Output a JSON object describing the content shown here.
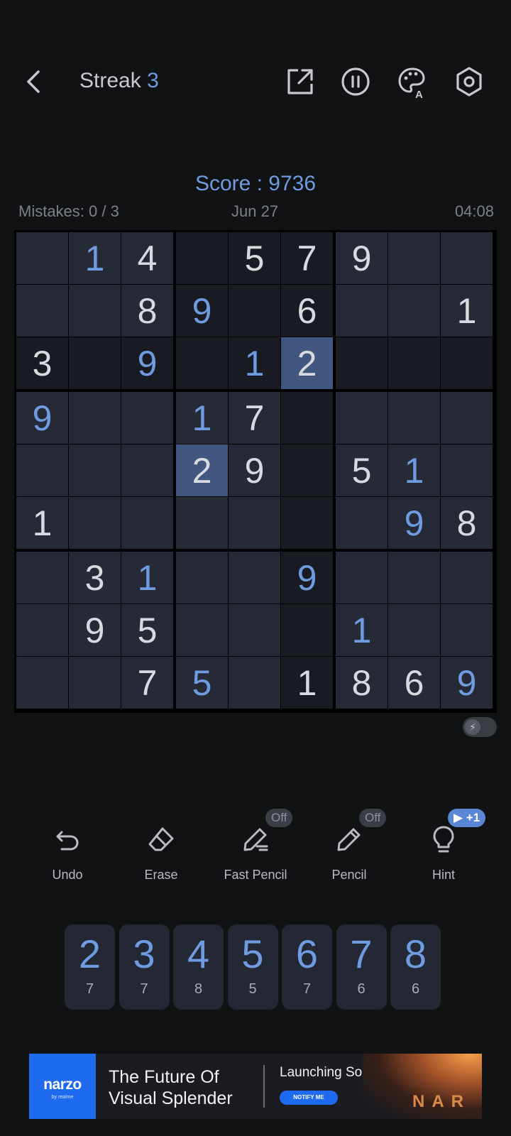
{
  "header": {
    "streak_label": "Streak",
    "streak_value": "3",
    "icons": [
      "back-arrow-icon",
      "share-icon",
      "pause-icon",
      "palette-icon",
      "settings-icon"
    ]
  },
  "score": {
    "text": "Score : 9736"
  },
  "stats": {
    "mistakes": "Mistakes: 0 / 3",
    "date": "Jun 27",
    "timer": "04:08"
  },
  "board": {
    "rows": [
      [
        null,
        {
          "v": "1",
          "t": "user"
        },
        {
          "v": "4",
          "t": "given"
        },
        null,
        {
          "v": "5",
          "t": "given"
        },
        {
          "v": "7",
          "t": "given"
        },
        {
          "v": "9",
          "t": "given"
        },
        null,
        null
      ],
      [
        null,
        null,
        {
          "v": "8",
          "t": "given"
        },
        {
          "v": "9",
          "t": "user"
        },
        null,
        {
          "v": "6",
          "t": "given"
        },
        null,
        null,
        {
          "v": "1",
          "t": "given"
        }
      ],
      [
        {
          "v": "3",
          "t": "given"
        },
        null,
        {
          "v": "9",
          "t": "user"
        },
        null,
        {
          "v": "1",
          "t": "user"
        },
        {
          "v": "2",
          "t": "user"
        },
        null,
        null,
        null
      ],
      [
        {
          "v": "9",
          "t": "user"
        },
        null,
        null,
        {
          "v": "1",
          "t": "user"
        },
        {
          "v": "7",
          "t": "given"
        },
        null,
        null,
        null,
        null
      ],
      [
        null,
        null,
        null,
        {
          "v": "2",
          "t": "given"
        },
        {
          "v": "9",
          "t": "given"
        },
        null,
        {
          "v": "5",
          "t": "given"
        },
        {
          "v": "1",
          "t": "user"
        },
        null
      ],
      [
        {
          "v": "1",
          "t": "given"
        },
        null,
        null,
        null,
        null,
        null,
        null,
        {
          "v": "9",
          "t": "user"
        },
        {
          "v": "8",
          "t": "given"
        }
      ],
      [
        null,
        {
          "v": "3",
          "t": "given"
        },
        {
          "v": "1",
          "t": "user"
        },
        null,
        null,
        {
          "v": "9",
          "t": "user"
        },
        null,
        null,
        null
      ],
      [
        null,
        {
          "v": "9",
          "t": "given"
        },
        {
          "v": "5",
          "t": "given"
        },
        null,
        null,
        null,
        {
          "v": "1",
          "t": "user"
        },
        null,
        null
      ],
      [
        null,
        null,
        {
          "v": "7",
          "t": "given"
        },
        {
          "v": "5",
          "t": "user"
        },
        null,
        {
          "v": "1",
          "t": "given"
        },
        {
          "v": "8",
          "t": "given"
        },
        {
          "v": "6",
          "t": "given"
        },
        {
          "v": "9",
          "t": "user"
        }
      ]
    ],
    "selected_row": 2,
    "selected_col": 5,
    "colors": {
      "cell": "#262a37",
      "highlight": "#191b22",
      "selected": "#41577f",
      "user_digit": "#6f9be1",
      "given_digit": "#d8dadf"
    }
  },
  "toggle": {
    "icon": "lightning-icon",
    "glyph": "⚡"
  },
  "tools": [
    {
      "label": "Undo",
      "icon": "undo-icon",
      "badge": ""
    },
    {
      "label": "Erase",
      "icon": "eraser-icon",
      "badge": ""
    },
    {
      "label": "Fast Pencil",
      "icon": "fast-pencil-icon",
      "badge": "Off"
    },
    {
      "label": "Pencil",
      "icon": "pencil-icon",
      "badge": "Off"
    },
    {
      "label": "Hint",
      "icon": "lightbulb-icon",
      "badge": "▶ +1"
    }
  ],
  "numpad": [
    {
      "digit": "2",
      "remaining": "7"
    },
    {
      "digit": "3",
      "remaining": "7"
    },
    {
      "digit": "4",
      "remaining": "8"
    },
    {
      "digit": "5",
      "remaining": "5"
    },
    {
      "digit": "6",
      "remaining": "7"
    },
    {
      "digit": "7",
      "remaining": "6"
    },
    {
      "digit": "8",
      "remaining": "6"
    }
  ],
  "ad": {
    "brand": "narzo",
    "brand_sub": "by realme",
    "headline_line1": "The Future Of",
    "headline_line2": "Visual Splender",
    "launch": "Launching Soon",
    "cta": "NOTIFY ME",
    "product": "NAR"
  }
}
